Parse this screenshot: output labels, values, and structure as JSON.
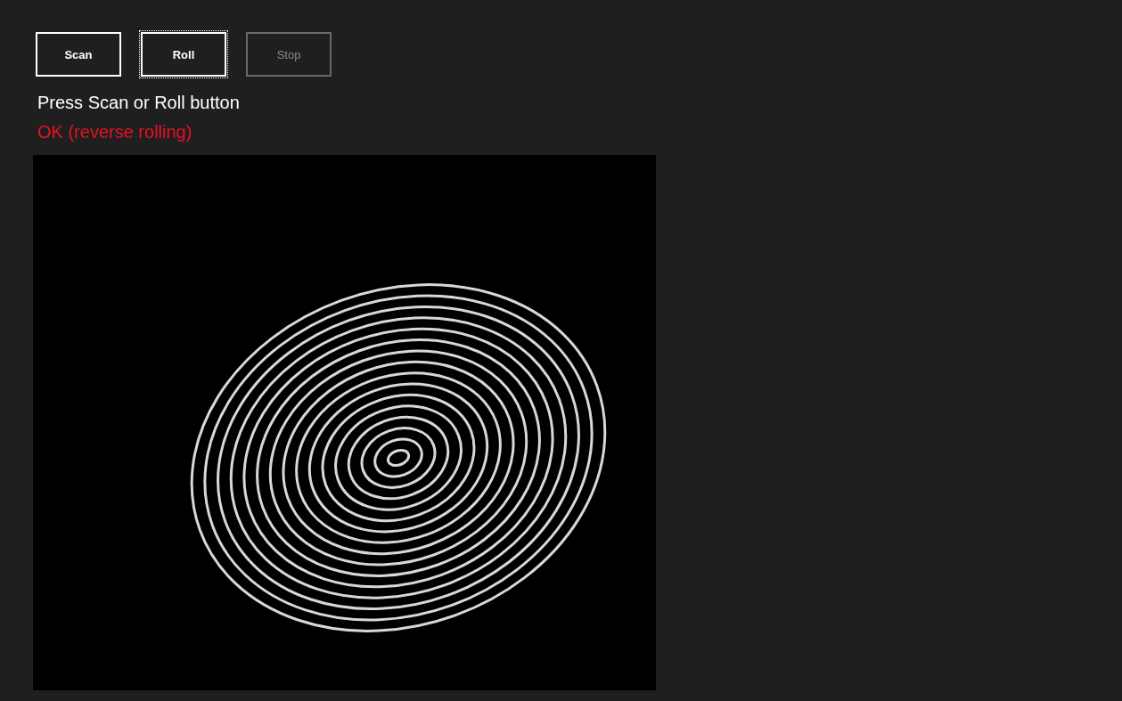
{
  "buttons": [
    {
      "label": "Scan",
      "disabled": false,
      "focused": false
    },
    {
      "label": "Roll",
      "disabled": false,
      "focused": true
    },
    {
      "label": "Stop",
      "disabled": true,
      "focused": false
    }
  ],
  "prompt": "Press Scan or Roll button",
  "status": {
    "text": "OK (reverse rolling)",
    "kind": "ok"
  }
}
